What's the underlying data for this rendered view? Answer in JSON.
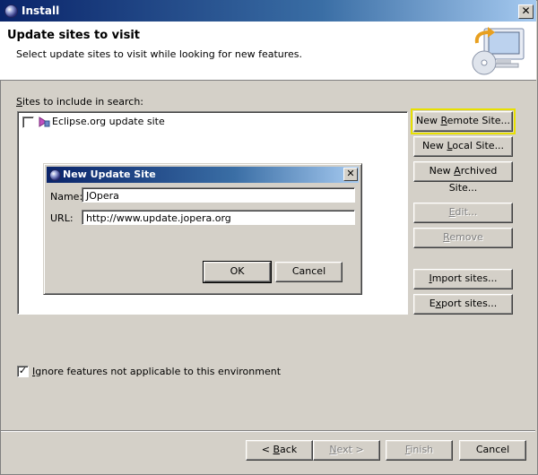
{
  "window": {
    "title": "Install"
  },
  "header": {
    "title": "Update sites to visit",
    "description": "Select update sites to visit while looking for new features."
  },
  "sites": {
    "label": "Sites to include in search:",
    "items": [
      {
        "label": "Eclipse.org update site",
        "checked": false
      }
    ]
  },
  "side_buttons": {
    "new_remote": "New Remote Site...",
    "new_local": "New Local Site...",
    "new_archived": "New Archived Site...",
    "edit": "Edit...",
    "remove": "Remove",
    "import": "Import sites...",
    "export": "Export sites..."
  },
  "ignore_features": {
    "label": "Ignore features not applicable to this environment",
    "checked": true
  },
  "footer": {
    "back": "< Back",
    "next": "Next >",
    "finish": "Finish",
    "cancel": "Cancel"
  },
  "dialog": {
    "title": "New Update Site",
    "name_label": "Name:",
    "name_value": "JOpera",
    "url_label": "URL:",
    "url_value": "http://www.update.jopera.org",
    "ok": "OK",
    "cancel": "Cancel"
  }
}
